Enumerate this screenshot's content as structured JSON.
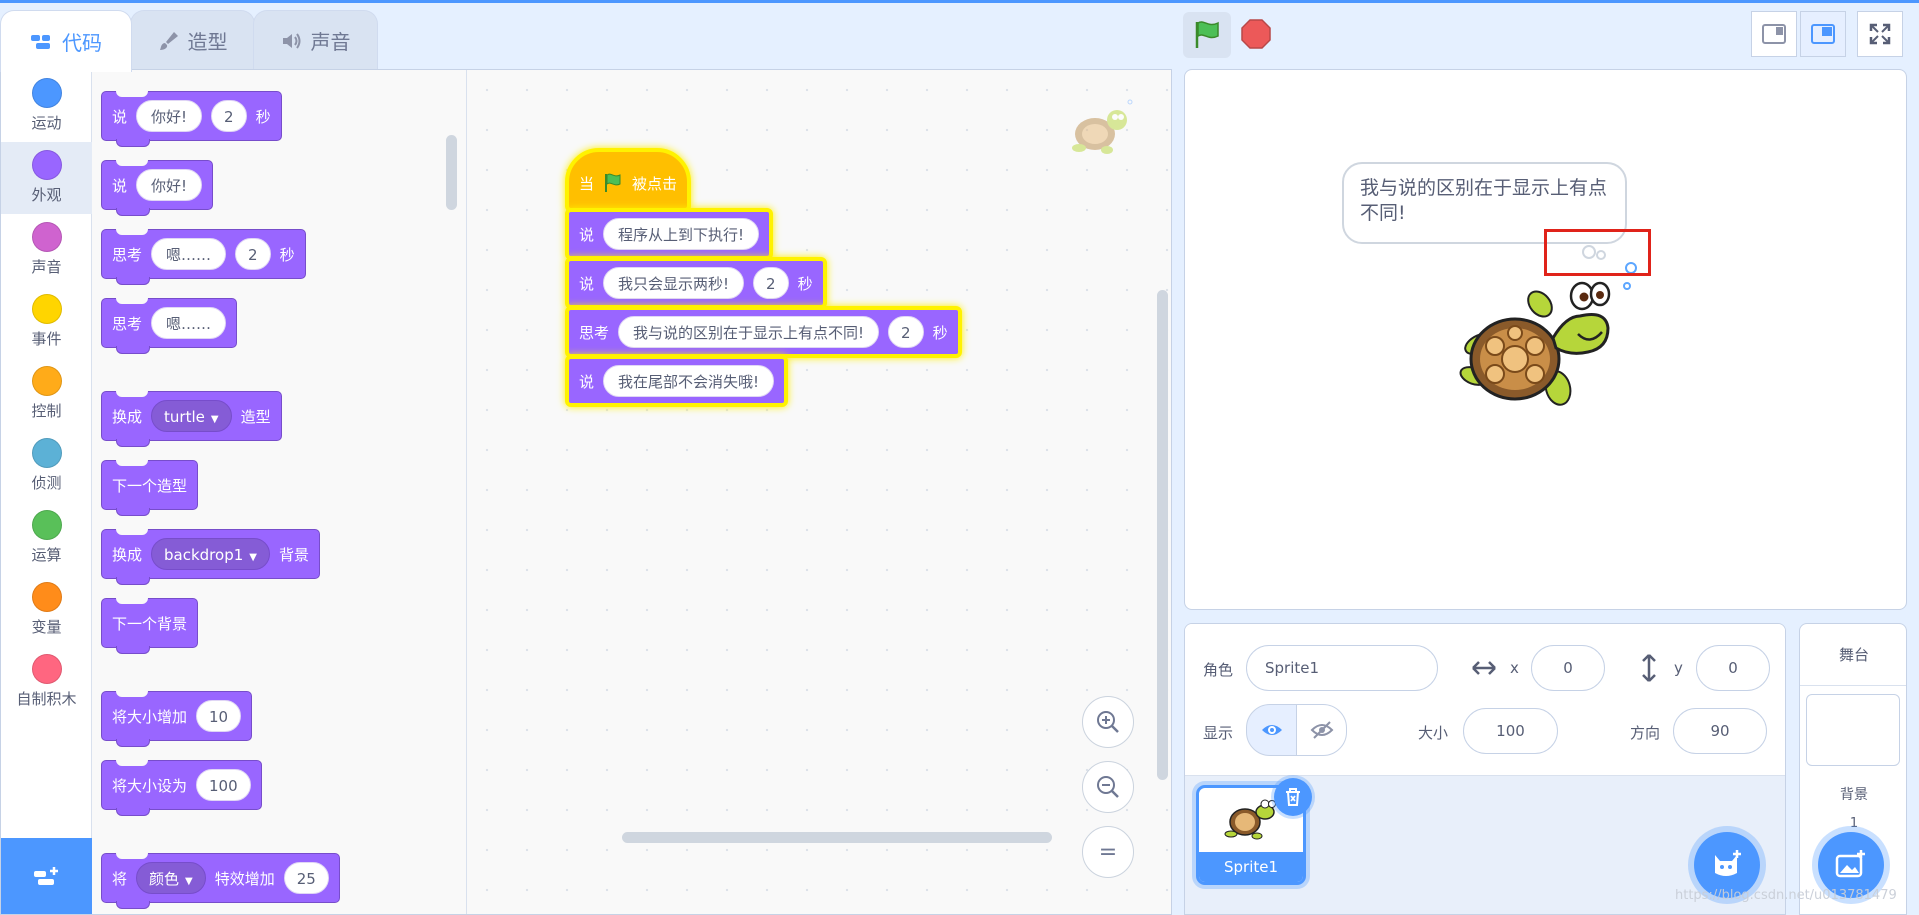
{
  "tabs": [
    {
      "label": "代码",
      "icon": "code-icon"
    },
    {
      "label": "造型",
      "icon": "brush-icon"
    },
    {
      "label": "声音",
      "icon": "speaker-icon"
    }
  ],
  "categories": [
    {
      "label": "运动",
      "color": "#4c97ff"
    },
    {
      "label": "外观",
      "color": "#9966ff"
    },
    {
      "label": "声音",
      "color": "#cf63cf"
    },
    {
      "label": "事件",
      "color": "#ffd500"
    },
    {
      "label": "控制",
      "color": "#ffab19"
    },
    {
      "label": "侦测",
      "color": "#5cb1d6"
    },
    {
      "label": "运算",
      "color": "#59c059"
    },
    {
      "label": "变量",
      "color": "#ff8c1a"
    },
    {
      "label": "自制积木",
      "color": "#ff6680"
    }
  ],
  "palette": {
    "say_secs": {
      "op": "说",
      "text": "你好!",
      "secs": "2",
      "unit": "秒"
    },
    "say": {
      "op": "说",
      "text": "你好!"
    },
    "think_secs": {
      "op": "思考",
      "text": "嗯……",
      "secs": "2",
      "unit": "秒"
    },
    "think": {
      "op": "思考",
      "text": "嗯……"
    },
    "switch_costume": {
      "op": "换成",
      "value": "turtle",
      "suffix": "造型"
    },
    "next_costume": {
      "op": "下一个造型"
    },
    "switch_backdrop": {
      "op": "换成",
      "value": "backdrop1",
      "suffix": "背景"
    },
    "next_backdrop": {
      "op": "下一个背景"
    },
    "change_size": {
      "op": "将大小增加",
      "value": "10"
    },
    "set_size": {
      "op": "将大小设为",
      "value": "100"
    },
    "change_effect": {
      "op": "将",
      "effect": "颜色",
      "suffix": "特效增加",
      "value": "25"
    }
  },
  "script": {
    "hat": {
      "prefix": "当",
      "suffix": "被点击"
    },
    "blocks": [
      {
        "op": "说",
        "text": "程序从上到下执行!"
      },
      {
        "op": "说",
        "text": "我只会显示两秒!",
        "secs": "2",
        "unit": "秒"
      },
      {
        "op": "思考",
        "text": "我与说的区别在于显示上有点不同!",
        "secs": "2",
        "unit": "秒"
      },
      {
        "op": "说",
        "text": "我在尾部不会消失哦!"
      }
    ]
  },
  "zoom": {
    "in": "+",
    "out": "−",
    "reset": "="
  },
  "stage": {
    "bubble_text": "我与说的区别在于显示上有点不同!"
  },
  "sprite_info": {
    "sprite_label": "角色",
    "sprite_name": "Sprite1",
    "x_label": "x",
    "x_value": "0",
    "y_label": "y",
    "y_value": "0",
    "show_label": "显示",
    "size_label": "大小",
    "size_value": "100",
    "direction_label": "方向",
    "direction_value": "90"
  },
  "sprites": [
    {
      "name": "Sprite1"
    }
  ],
  "stage_selector": {
    "title": "舞台",
    "backdrops_label": "背景",
    "backdrops_count": "1"
  },
  "watermark": "https://blog.csdn.net/u013781479",
  "colors": {
    "accent": "#4c97ff",
    "looks": "#9966ff",
    "events": "#ffbf00",
    "highlight": "#fff200",
    "annotation": "#e0231a"
  }
}
